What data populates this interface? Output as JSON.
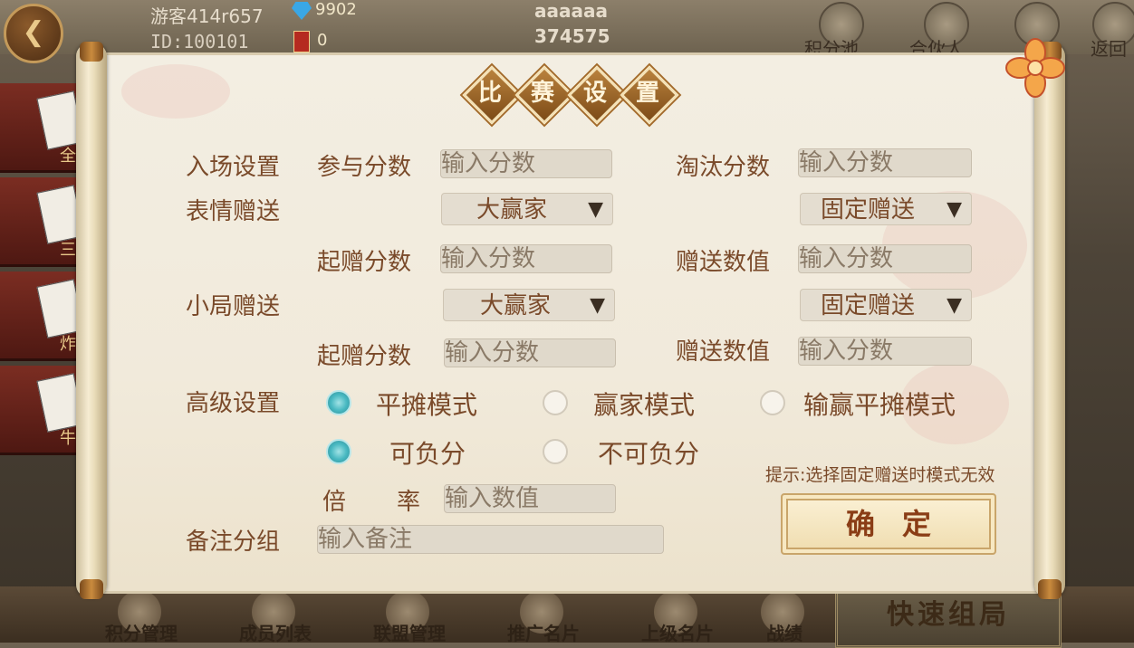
{
  "header": {
    "player_name": "游客414r657",
    "player_id": "ID:100101",
    "diamonds": "9902",
    "room_cards": "0",
    "room_name": "aaaaaa",
    "room_number": "374575",
    "icons": [
      {
        "label": "积分池",
        "icon": "coins-icon"
      },
      {
        "label": "合伙人",
        "icon": "handshake-icon"
      },
      {
        "label": "",
        "icon": "document-icon"
      },
      {
        "label": "返回",
        "icon": "exit-icon"
      }
    ]
  },
  "side_games": [
    {
      "label": "全"
    },
    {
      "label": "三"
    },
    {
      "label": "炸"
    },
    {
      "label": "牛"
    }
  ],
  "bottom_nav": [
    {
      "label": "积分管理",
      "icon": "coins-gear-icon"
    },
    {
      "label": "成员列表",
      "icon": "members-icon"
    },
    {
      "label": "联盟管理",
      "icon": "alliance-icon"
    },
    {
      "label": "推广名片",
      "icon": "gear-icon"
    },
    {
      "label": "上级名片",
      "icon": "card-icon"
    },
    {
      "label": "战绩",
      "icon": "trophy-icon"
    }
  ],
  "quick_button": "快速组局",
  "dialog": {
    "title_chars": [
      "比",
      "赛",
      "设",
      "置"
    ],
    "entry": {
      "label": "入场设置",
      "join_label": "参与分数",
      "join_placeholder": "输入分数",
      "elim_label": "淘汰分数",
      "elim_placeholder": "输入分数"
    },
    "emoji_gift": {
      "label": "表情赠送",
      "target_select": "大赢家",
      "mode_select": "固定赠送",
      "start_label": "起赠分数",
      "start_placeholder": "输入分数",
      "value_label": "赠送数值",
      "value_placeholder": "输入分数"
    },
    "round_gift": {
      "label": "小局赠送",
      "target_select": "大赢家",
      "mode_select": "固定赠送",
      "start_label": "起赠分数",
      "start_placeholder": "输入分数",
      "value_label": "赠送数值",
      "value_placeholder": "输入分数"
    },
    "advanced": {
      "label": "高级设置",
      "mode_options": [
        "平摊模式",
        "赢家模式",
        "输赢平摊模式"
      ],
      "mode_selected": 0,
      "negative_options": [
        "可负分",
        "不可负分"
      ],
      "negative_selected": 0,
      "rate_label_1": "倍",
      "rate_label_2": "率",
      "rate_placeholder": "输入数值"
    },
    "hint": "提示:选择固定赠送时模式无效",
    "remark": {
      "label": "备注分组",
      "placeholder": "输入备注"
    },
    "confirm_label": "确定",
    "colors": {
      "label": "#7a4a2a",
      "radio_on": "#49b9c2",
      "paper": "#f1eadb"
    }
  }
}
